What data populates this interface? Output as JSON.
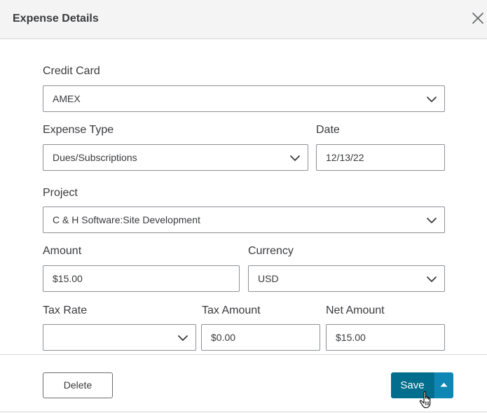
{
  "dialog": {
    "title": "Expense Details",
    "close_icon": "close-icon"
  },
  "form": {
    "credit_card": {
      "label": "Credit Card",
      "value": "AMEX"
    },
    "expense_type": {
      "label": "Expense Type",
      "value": "Dues/Subscriptions"
    },
    "date": {
      "label": "Date",
      "value": "12/13/22"
    },
    "project": {
      "label": "Project",
      "value": "C & H Software:Site Development"
    },
    "amount": {
      "label": "Amount",
      "value": "$15.00"
    },
    "currency": {
      "label": "Currency",
      "value": "USD"
    },
    "tax_rate": {
      "label": "Tax Rate",
      "value": ""
    },
    "tax_amount": {
      "label": "Tax Amount",
      "value": "$0.00"
    },
    "net_amount": {
      "label": "Net Amount",
      "value": "$15.00"
    }
  },
  "footer": {
    "delete_label": "Delete",
    "save_label": "Save",
    "save_more_icon": "caret-up-icon"
  },
  "colors": {
    "save_primary": "#006e8c",
    "save_secondary": "#0e87b4",
    "header_bg": "#f4f4f4"
  }
}
